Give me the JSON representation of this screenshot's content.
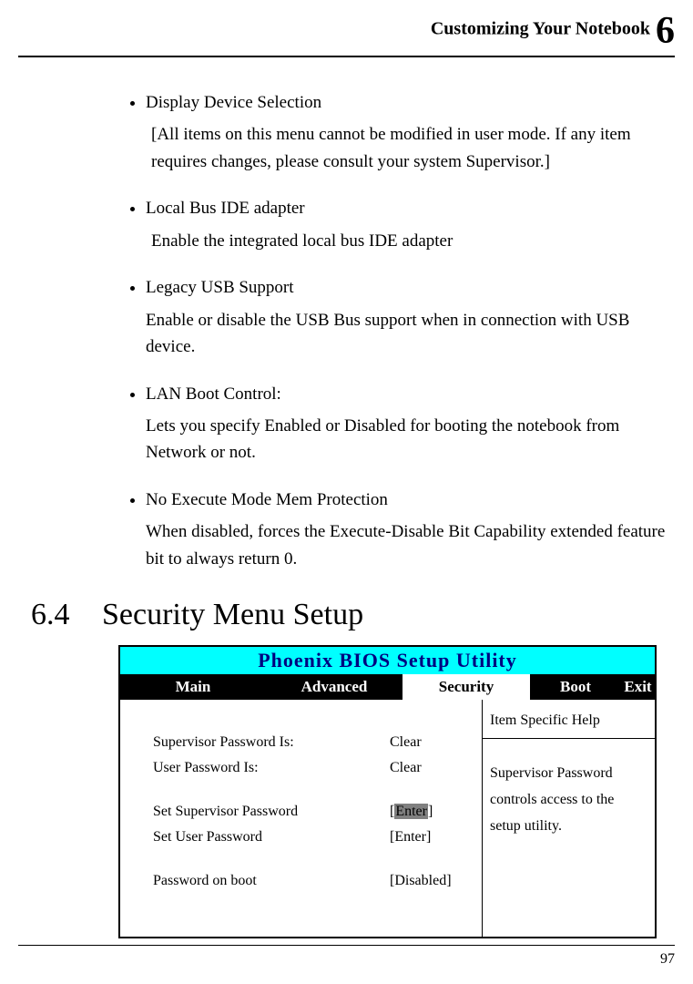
{
  "header": {
    "title": "Customizing Your Notebook",
    "chapter": "6"
  },
  "bullets": [
    {
      "title": "Display Device Selection",
      "desc": "[All items on this menu cannot be modified in user mode. If any item requires changes, please consult your system Supervisor.]"
    },
    {
      "title": "Local Bus IDE adapter",
      "desc": "Enable the integrated local bus IDE adapter"
    },
    {
      "title": "Legacy USB Support",
      "desc": "Enable or disable the USB Bus support when in connection with USB device."
    },
    {
      "title": "LAN Boot Control:",
      "desc": "Lets you specify Enabled or Disabled for booting the notebook from Network or not."
    },
    {
      "title": "No Execute Mode Mem Protection",
      "desc": "When disabled, forces the Execute-Disable Bit Capability extended feature bit to always return 0."
    }
  ],
  "section": {
    "num": "6.4",
    "title": "Security Menu Setup"
  },
  "bios": {
    "title": "Phoenix BIOS Setup Utility",
    "tabs": {
      "main": "Main",
      "advanced": "Advanced",
      "security": "Security",
      "boot": "Boot",
      "exit": "Exit"
    },
    "rows": {
      "sup_pw_is_label": "Supervisor Password Is:",
      "sup_pw_is_val": "Clear",
      "user_pw_is_label": "User Password Is:",
      "user_pw_is_val": "Clear",
      "set_sup_label": "Set Supervisor Password",
      "set_sup_val_pre": "[",
      "set_sup_val_mid": "Enter",
      "set_sup_val_post": "]",
      "set_user_label": "Set User Password",
      "set_user_val": "[Enter]",
      "pw_boot_label": "Password on boot",
      "pw_boot_val": "[Disabled]"
    },
    "help": {
      "title": "Item Specific Help",
      "body": "Supervisor Password controls access to the setup utility."
    }
  },
  "page_number": "97"
}
